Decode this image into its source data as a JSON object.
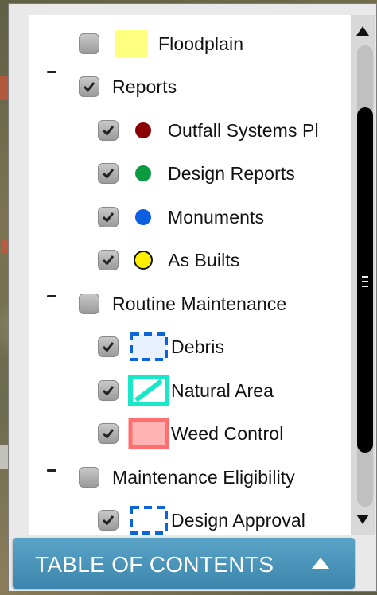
{
  "toc": {
    "title": "TABLE OF CONTENTS",
    "toggle_icon": "triangle-up-icon",
    "items": [
      {
        "label": "Floodplain",
        "checked": false,
        "level": 1,
        "symbol": "yellow-square",
        "color": "#ffff80"
      },
      {
        "label": "Reports",
        "checked": true,
        "level": 0,
        "expanded": true
      },
      {
        "label": "Outfall Systems Pl",
        "checked": true,
        "level": 1,
        "symbol": "dot",
        "color": "#8b0000"
      },
      {
        "label": "Design Reports",
        "checked": true,
        "level": 1,
        "symbol": "dot",
        "color": "#0a9b40"
      },
      {
        "label": "Monuments",
        "checked": true,
        "level": 1,
        "symbol": "dot",
        "color": "#0b5fe0"
      },
      {
        "label": "As Builts",
        "checked": true,
        "level": 1,
        "symbol": "ring",
        "color": "#ffee00"
      },
      {
        "label": "Routine Maintenance",
        "checked": false,
        "level": 0,
        "expanded": true
      },
      {
        "label": "Debris",
        "checked": true,
        "level": 1,
        "symbol": "dashed-box",
        "color": "#0b64d8"
      },
      {
        "label": "Natural Area",
        "checked": true,
        "level": 1,
        "symbol": "hatched-box",
        "color": "#19e8c8"
      },
      {
        "label": "Weed Control",
        "checked": true,
        "level": 1,
        "symbol": "filled-box",
        "color": "#ff8f8f"
      },
      {
        "label": "Maintenance Eligibility",
        "checked": false,
        "level": 0,
        "expanded": true
      },
      {
        "label": "Design Approval",
        "checked": true,
        "level": 1,
        "symbol": "dashed-box",
        "color": "#0b64d8"
      }
    ]
  },
  "scrollbar": {
    "up_icon": "triangle-up-icon",
    "down_icon": "triangle-down-icon",
    "grip_icon": "grip-icon"
  }
}
